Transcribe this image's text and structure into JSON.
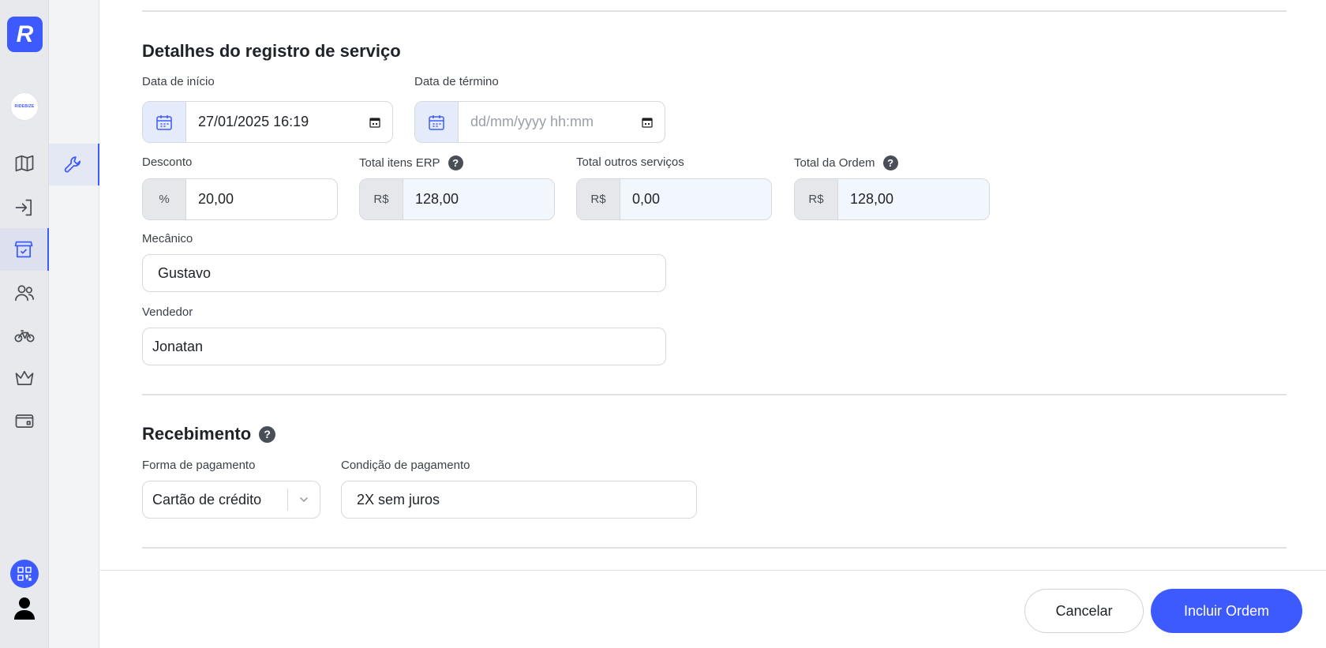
{
  "app": {
    "logo_letter": "R",
    "brand_text": "RIDEBIZE",
    "accent_color": "#3d5afe"
  },
  "rail": {
    "items": [
      {
        "icon": "map-icon"
      },
      {
        "icon": "login-icon"
      },
      {
        "icon": "store-icon",
        "active": true
      },
      {
        "icon": "users-icon"
      },
      {
        "icon": "bike-icon"
      },
      {
        "icon": "crown-icon"
      },
      {
        "icon": "wallet-icon"
      }
    ],
    "bottom": [
      {
        "icon": "qr-code-icon"
      },
      {
        "icon": "user-icon"
      }
    ]
  },
  "subnav": {
    "items": [
      {
        "icon": "wrench-icon",
        "active": true
      }
    ]
  },
  "service_details": {
    "title": "Detalhes do registro de serviço",
    "start_date": {
      "label": "Data de início",
      "value": "27/01/2025 16:19"
    },
    "end_date": {
      "label": "Data de término",
      "placeholder": "dd/mm/yyyy hh:mm"
    },
    "discount": {
      "label": "Desconto",
      "prefix": "%",
      "value": "20,00"
    },
    "total_erp": {
      "label": "Total itens ERP",
      "prefix": "R$",
      "value": "128,00"
    },
    "total_other": {
      "label": "Total outros serviços",
      "prefix": "R$",
      "value": "0,00"
    },
    "total_order": {
      "label": "Total da Ordem",
      "prefix": "R$",
      "value": "128,00"
    },
    "mechanic": {
      "label": "Mecânico",
      "value": "Gustavo"
    },
    "seller": {
      "label": "Vendedor",
      "value": "Jonatan"
    }
  },
  "receipt": {
    "title": "Recebimento",
    "payment_method": {
      "label": "Forma de pagamento",
      "value": "Cartão de crédito"
    },
    "payment_condition": {
      "label": "Condição de pagamento",
      "value": "2X sem juros"
    }
  },
  "footer": {
    "cancel_label": "Cancelar",
    "submit_label": "Incluir Ordem"
  },
  "help_glyph": "?"
}
